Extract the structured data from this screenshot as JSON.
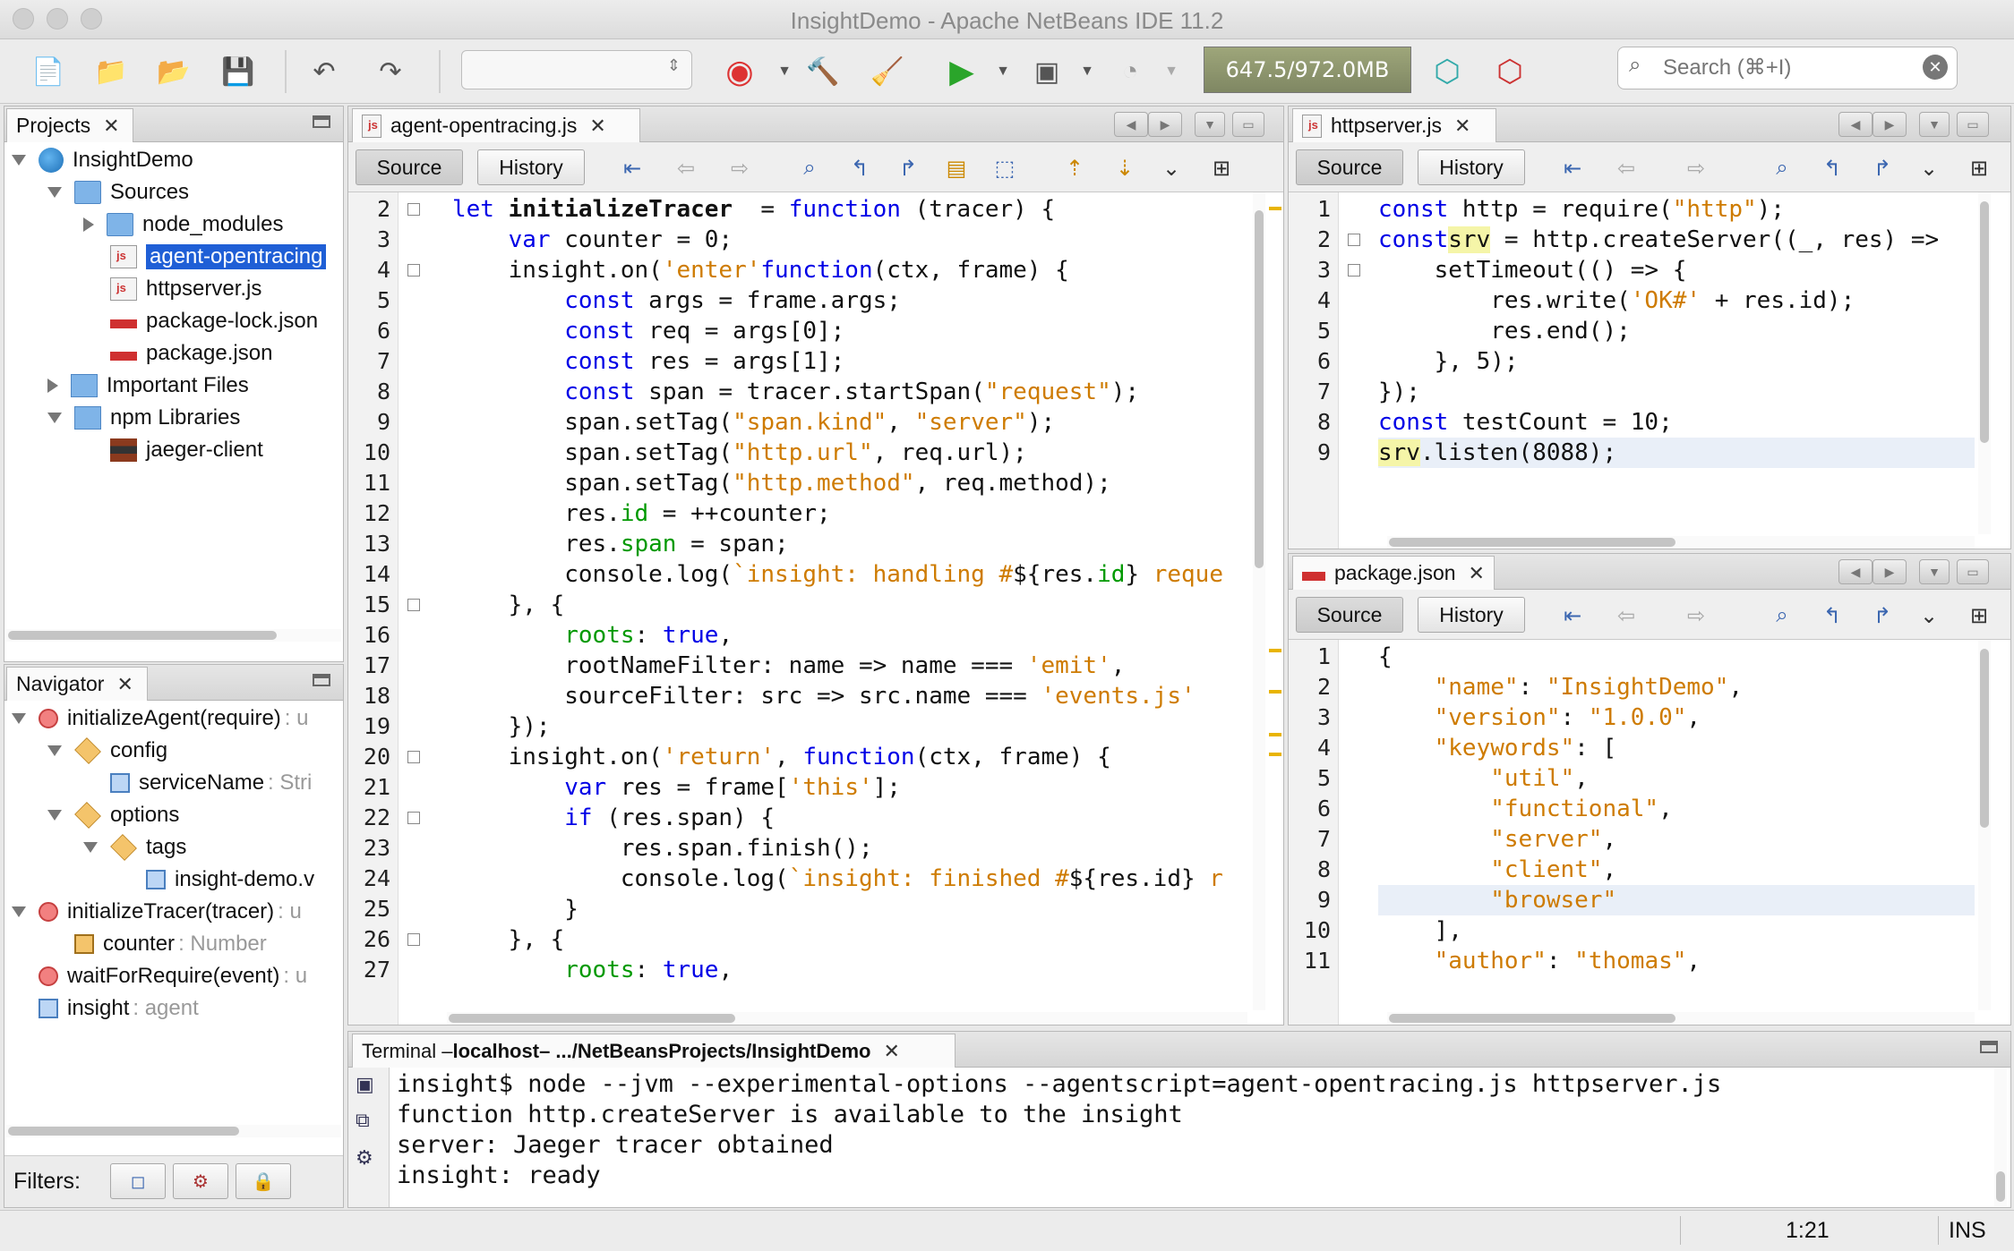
{
  "window": {
    "title": "InsightDemo - Apache NetBeans IDE 11.2"
  },
  "toolbar": {
    "memory": "647.5/972.0MB",
    "search_placeholder": "Search (⌘+I)",
    "icons": [
      "new-file-icon",
      "new-project-icon",
      "open-project-icon",
      "save-all-icon",
      "undo-icon",
      "redo-icon",
      "chrome-icon",
      "build-icon",
      "clean-build-icon",
      "run-icon",
      "debug-icon",
      "profile-icon",
      "gc-icon",
      "gc-profile-icon"
    ]
  },
  "projects": {
    "tab": "Projects",
    "items": [
      {
        "label": "InsightDemo",
        "depth": 0,
        "twist": "open",
        "icon": "globe"
      },
      {
        "label": "Sources",
        "depth": 1,
        "twist": "open",
        "icon": "folder"
      },
      {
        "label": "node_modules",
        "depth": 2,
        "twist": "closed",
        "icon": "folder"
      },
      {
        "label": "agent-opentracing",
        "depth": 2,
        "twist": "",
        "icon": "js",
        "selected": true
      },
      {
        "label": "httpserver.js",
        "depth": 2,
        "twist": "",
        "icon": "js"
      },
      {
        "label": "package-lock.json",
        "depth": 2,
        "twist": "",
        "icon": "npm"
      },
      {
        "label": "package.json",
        "depth": 2,
        "twist": "",
        "icon": "npm"
      },
      {
        "label": "Important Files",
        "depth": 1,
        "twist": "closed",
        "icon": "lib"
      },
      {
        "label": "npm Libraries",
        "depth": 1,
        "twist": "open",
        "icon": "lib"
      },
      {
        "label": "jaeger-client",
        "depth": 2,
        "twist": "",
        "icon": "books"
      }
    ]
  },
  "navigator": {
    "tab": "Navigator",
    "items": [
      {
        "label": "initializeAgent(require)",
        "dim": ": u",
        "depth": 0,
        "twist": "open",
        "icon": "circ"
      },
      {
        "label": "config",
        "dim": "",
        "depth": 1,
        "twist": "open",
        "icon": "pkg"
      },
      {
        "label": "serviceName",
        "dim": ": Stri",
        "depth": 2,
        "twist": "",
        "icon": "sq"
      },
      {
        "label": "options",
        "dim": "",
        "depth": 1,
        "twist": "open",
        "icon": "pkg"
      },
      {
        "label": "tags",
        "dim": "",
        "depth": 2,
        "twist": "open",
        "icon": "pkg"
      },
      {
        "label": "insight-demo.v",
        "dim": "",
        "depth": 3,
        "twist": "",
        "icon": "sq"
      },
      {
        "label": "initializeTracer(tracer)",
        "dim": ": u",
        "depth": 0,
        "twist": "open",
        "icon": "circ"
      },
      {
        "label": "counter",
        "dim": ": Number",
        "depth": 1,
        "twist": "",
        "icon": "lock"
      },
      {
        "label": "waitForRequire(event)",
        "dim": ": u",
        "depth": 0,
        "twist": "",
        "icon": "circ"
      },
      {
        "label": "insight",
        "dim": ": agent",
        "depth": 0,
        "twist": "",
        "icon": "sq"
      }
    ],
    "filters_label": "Filters:"
  },
  "editor_main": {
    "tab": "agent-opentracing.js",
    "source": "Source",
    "history": "History",
    "lines": [
      {
        "n": "2",
        "t": [
          [
            "kw",
            "let "
          ],
          [
            "fn",
            "initializeTracer"
          ],
          [
            "",
            "  = "
          ],
          [
            "kw",
            "function"
          ],
          [
            "",
            " (tracer) {"
          ]
        ]
      },
      {
        "n": "3",
        "t": [
          [
            "",
            "    "
          ],
          [
            "kw",
            "var"
          ],
          [
            "",
            " counter = 0;"
          ]
        ]
      },
      {
        "n": "4",
        "t": [
          [
            "",
            "    insight.on("
          ],
          [
            "st",
            "'enter'"
          ],
          [
            ", "
          ],
          [
            "kw",
            "function"
          ],
          [
            "",
            "(ctx, frame) {"
          ]
        ]
      },
      {
        "n": "5",
        "t": [
          [
            "",
            "        "
          ],
          [
            "kw",
            "const"
          ],
          [
            "",
            " args = frame.args;"
          ]
        ]
      },
      {
        "n": "6",
        "t": [
          [
            "",
            "        "
          ],
          [
            "kw",
            "const"
          ],
          [
            "",
            " req = args[0];"
          ]
        ]
      },
      {
        "n": "7",
        "t": [
          [
            "",
            "        "
          ],
          [
            "kw",
            "const"
          ],
          [
            "",
            " res = args[1];"
          ]
        ]
      },
      {
        "n": "8",
        "t": [
          [
            "",
            "        "
          ],
          [
            "kw",
            "const"
          ],
          [
            "",
            " span = tracer.startSpan("
          ],
          [
            "st",
            "\"request\""
          ],
          [
            "",
            ");"
          ]
        ]
      },
      {
        "n": "9",
        "t": [
          [
            "",
            "        span.setTag("
          ],
          [
            "st",
            "\"span.kind\""
          ],
          [
            "",
            ", "
          ],
          [
            "st",
            "\"server\""
          ],
          [
            "",
            ");"
          ]
        ]
      },
      {
        "n": "10",
        "t": [
          [
            "",
            "        span.setTag("
          ],
          [
            "st",
            "\"http.url\""
          ],
          [
            "",
            ", req.url);"
          ]
        ]
      },
      {
        "n": "11",
        "t": [
          [
            "",
            "        span.setTag("
          ],
          [
            "st",
            "\"http.method\""
          ],
          [
            "",
            ", req.method);"
          ]
        ]
      },
      {
        "n": "12",
        "t": [
          [
            "",
            "        res."
          ],
          [
            "pr",
            "id"
          ],
          [
            "",
            " = ++counter;"
          ]
        ]
      },
      {
        "n": "13",
        "t": [
          [
            "",
            "        res."
          ],
          [
            "pr",
            "span"
          ],
          [
            "",
            " = span;"
          ]
        ]
      },
      {
        "n": "14",
        "t": [
          [
            "",
            "        console.log("
          ],
          [
            "st",
            "`insight: handling #"
          ],
          [
            "",
            "${res."
          ],
          [
            "pr",
            "id"
          ],
          [
            "",
            "}"
          ],
          [
            "st",
            " reque"
          ]
        ]
      },
      {
        "n": "15",
        "t": [
          [
            "",
            "    }, {"
          ]
        ]
      },
      {
        "n": "16",
        "t": [
          [
            "",
            "        "
          ],
          [
            "pr",
            "roots"
          ],
          [
            "",
            ": "
          ],
          [
            "kw",
            "true"
          ],
          [
            "",
            ","
          ]
        ]
      },
      {
        "n": "17",
        "t": [
          [
            "",
            "        rootNameFilter: name => name === "
          ],
          [
            "st",
            "'emit'"
          ],
          [
            "",
            ","
          ]
        ]
      },
      {
        "n": "18",
        "t": [
          [
            "",
            "        sourceFilter: src => src.name === "
          ],
          [
            "st",
            "'events.js'"
          ]
        ]
      },
      {
        "n": "19",
        "t": [
          [
            "",
            "    });"
          ]
        ]
      },
      {
        "n": "20",
        "t": [
          [
            "",
            "    insight.on("
          ],
          [
            "st",
            "'return'"
          ],
          [
            "",
            ", "
          ],
          [
            "kw",
            "function"
          ],
          [
            "",
            "(ctx, frame) {"
          ]
        ]
      },
      {
        "n": "21",
        "t": [
          [
            "",
            "        "
          ],
          [
            "kw",
            "var"
          ],
          [
            "",
            " res = frame["
          ],
          [
            "st",
            "'this'"
          ],
          [
            "",
            "];"
          ]
        ]
      },
      {
        "n": "22",
        "t": [
          [
            "",
            "        "
          ],
          [
            "kw",
            "if"
          ],
          [
            "",
            " (res.span) {"
          ]
        ]
      },
      {
        "n": "23",
        "t": [
          [
            "",
            "            res.span.finish();"
          ]
        ]
      },
      {
        "n": "24",
        "t": [
          [
            "",
            "            console.log("
          ],
          [
            "st",
            "`insight: finished #"
          ],
          [
            "",
            "${res.id}"
          ],
          [
            "st",
            " r"
          ]
        ]
      },
      {
        "n": "25",
        "t": [
          [
            "",
            "        }"
          ]
        ]
      },
      {
        "n": "26",
        "t": [
          [
            "",
            "    }, {"
          ]
        ]
      },
      {
        "n": "27",
        "t": [
          [
            "",
            "        "
          ],
          [
            "pr",
            "roots"
          ],
          [
            "",
            ": "
          ],
          [
            "kw",
            "true"
          ],
          [
            "",
            ","
          ]
        ]
      }
    ]
  },
  "editor_http": {
    "tab": "httpserver.js",
    "source": "Source",
    "history": "History",
    "lines": [
      {
        "n": "1",
        "t": [
          [
            "kw",
            "const"
          ],
          [
            "",
            " http = require("
          ],
          [
            "st",
            "\"http\""
          ],
          [
            "",
            ");"
          ]
        ]
      },
      {
        "n": "2",
        "t": [
          [
            "kw",
            "const"
          ],
          [
            " "
          ],
          [
            "hl",
            "srv"
          ],
          [
            "",
            " = http.createServer((_, res) =>"
          ]
        ]
      },
      {
        "n": "3",
        "t": [
          [
            "",
            "    setTimeout(() => {"
          ]
        ]
      },
      {
        "n": "4",
        "t": [
          [
            "",
            "        res.write("
          ],
          [
            "st",
            "'OK#'"
          ],
          [
            "",
            " + res.id);"
          ]
        ]
      },
      {
        "n": "5",
        "t": [
          [
            "",
            "        res.end();"
          ]
        ]
      },
      {
        "n": "6",
        "t": [
          [
            "",
            "    }, 5);"
          ]
        ]
      },
      {
        "n": "7",
        "t": [
          [
            "",
            "});"
          ]
        ]
      },
      {
        "n": "8",
        "t": [
          [
            "kw",
            "const"
          ],
          [
            "",
            " testCount = 10;"
          ]
        ]
      },
      {
        "n": "9",
        "t": [
          [
            "hl",
            "srv"
          ],
          [
            "",
            ".listen(8088);"
          ]
        ]
      }
    ]
  },
  "editor_pkg": {
    "tab": "package.json",
    "source": "Source",
    "history": "History",
    "lines": [
      {
        "n": "1",
        "t": [
          [
            "",
            "{"
          ]
        ]
      },
      {
        "n": "2",
        "t": [
          [
            "",
            "    "
          ],
          [
            "st",
            "\"name\""
          ],
          [
            "",
            ": "
          ],
          [
            "st",
            "\"InsightDemo\""
          ],
          [
            "",
            ","
          ]
        ]
      },
      {
        "n": "3",
        "t": [
          [
            "",
            "    "
          ],
          [
            "st",
            "\"version\""
          ],
          [
            "",
            ": "
          ],
          [
            "st",
            "\"1.0.0\""
          ],
          [
            "",
            ","
          ]
        ]
      },
      {
        "n": "4",
        "t": [
          [
            "",
            "    "
          ],
          [
            "st",
            "\"keywords\""
          ],
          [
            "",
            ": ["
          ]
        ]
      },
      {
        "n": "5",
        "t": [
          [
            "",
            "        "
          ],
          [
            "st",
            "\"util\""
          ],
          [
            "",
            ","
          ]
        ]
      },
      {
        "n": "6",
        "t": [
          [
            "",
            "        "
          ],
          [
            "st",
            "\"functional\""
          ],
          [
            "",
            ","
          ]
        ]
      },
      {
        "n": "7",
        "t": [
          [
            "",
            "        "
          ],
          [
            "st",
            "\"server\""
          ],
          [
            "",
            ","
          ]
        ]
      },
      {
        "n": "8",
        "t": [
          [
            "",
            "        "
          ],
          [
            "st",
            "\"client\""
          ],
          [
            "",
            ","
          ]
        ]
      },
      {
        "n": "9",
        "t": [
          [
            "",
            "        "
          ],
          [
            "st",
            "\"browser\""
          ]
        ]
      },
      {
        "n": "10",
        "t": [
          [
            "",
            "    ],"
          ]
        ]
      },
      {
        "n": "11",
        "t": [
          [
            "",
            "    "
          ],
          [
            "st",
            "\"author\""
          ],
          [
            "",
            ": "
          ],
          [
            "st",
            "\"thomas\""
          ],
          [
            "",
            ","
          ]
        ]
      }
    ]
  },
  "terminal": {
    "tab_prefix": "Terminal – ",
    "tab_host": "localhost",
    "tab_path": " – .../NetBeansProjects/InsightDemo",
    "lines": [
      "insight$ node --jvm --experimental-options --agentscript=agent-opentracing.js httpserver.js",
      "function http.createServer is available to the insight",
      "server: Jaeger tracer obtained",
      "insight: ready"
    ]
  },
  "status": {
    "position": "1:21",
    "mode": "INS"
  }
}
